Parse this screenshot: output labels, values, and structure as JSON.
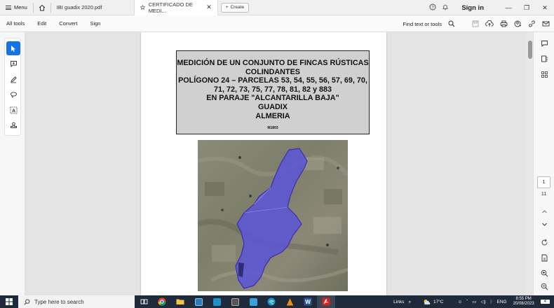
{
  "tabbar": {
    "menu_label": "Menu",
    "tabs": [
      {
        "label": "IBI guadix 2020.pdf"
      },
      {
        "label": "CERTIFICADO DE MEDI...",
        "close": "✕"
      }
    ],
    "create_label": "Create",
    "sign_in": "Sign in"
  },
  "toolbar": {
    "items": [
      "All tools",
      "Edit",
      "Convert",
      "Sign"
    ],
    "find_label": "Find text or tools"
  },
  "document": {
    "title_lines": [
      "MEDICIÓN DE UN CONJUNTO DE FINCAS RÚSTICAS",
      "COLINDANTES",
      "POLÍGONO 24 – PARCELAS 53, 54, 55, 56, 57, 69, 70,",
      "71, 72, 73, 75, 77, 78, 81, 82 y 883",
      "EN PARAJE \"ALCANTARILLA BAJA\"",
      "GUADIX",
      "ALMERIA"
    ],
    "code": "M1803"
  },
  "pager": {
    "current": "1",
    "total": "11"
  },
  "taskbar": {
    "search_placeholder": "Type here to search",
    "links_label": "Links",
    "weather": "17°C",
    "language": "ENG",
    "time": "8:55 PM",
    "date": "20/08/2023",
    "notifications": "4"
  },
  "colors": {
    "accent": "#1473e6",
    "parcel_fill": "#5a55d8",
    "taskbar": "#1f2b3a"
  }
}
